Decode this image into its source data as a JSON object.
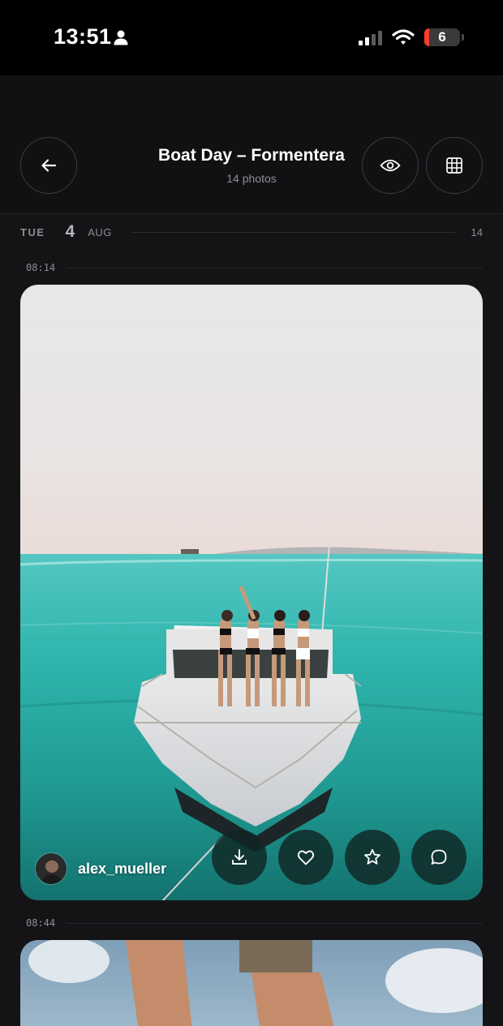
{
  "status_bar": {
    "time": "13:51",
    "battery_level": "6",
    "icons": [
      "person-icon",
      "cellular-signal-icon",
      "wifi-icon",
      "battery-icon"
    ]
  },
  "header": {
    "title": "Boat Day – Formentera",
    "subtitle": "14 photos",
    "icons": [
      "back-arrow-icon",
      "eye-icon",
      "grid-icon"
    ]
  },
  "date_group": {
    "weekday": "TUE",
    "day": "4",
    "month": "AUG",
    "count": "14"
  },
  "photos": [
    {
      "time": "08:14",
      "uploader": "alex_mueller",
      "actions": [
        "download-icon",
        "heart-icon",
        "star-icon",
        "comment-icon"
      ]
    },
    {
      "time": "08:44"
    }
  ],
  "colors": {
    "background": "#141416",
    "header_background": "#111113",
    "status_bar_background": "#000000",
    "muted_text": "#8e8e93",
    "battery_low": "#ff3b30"
  }
}
